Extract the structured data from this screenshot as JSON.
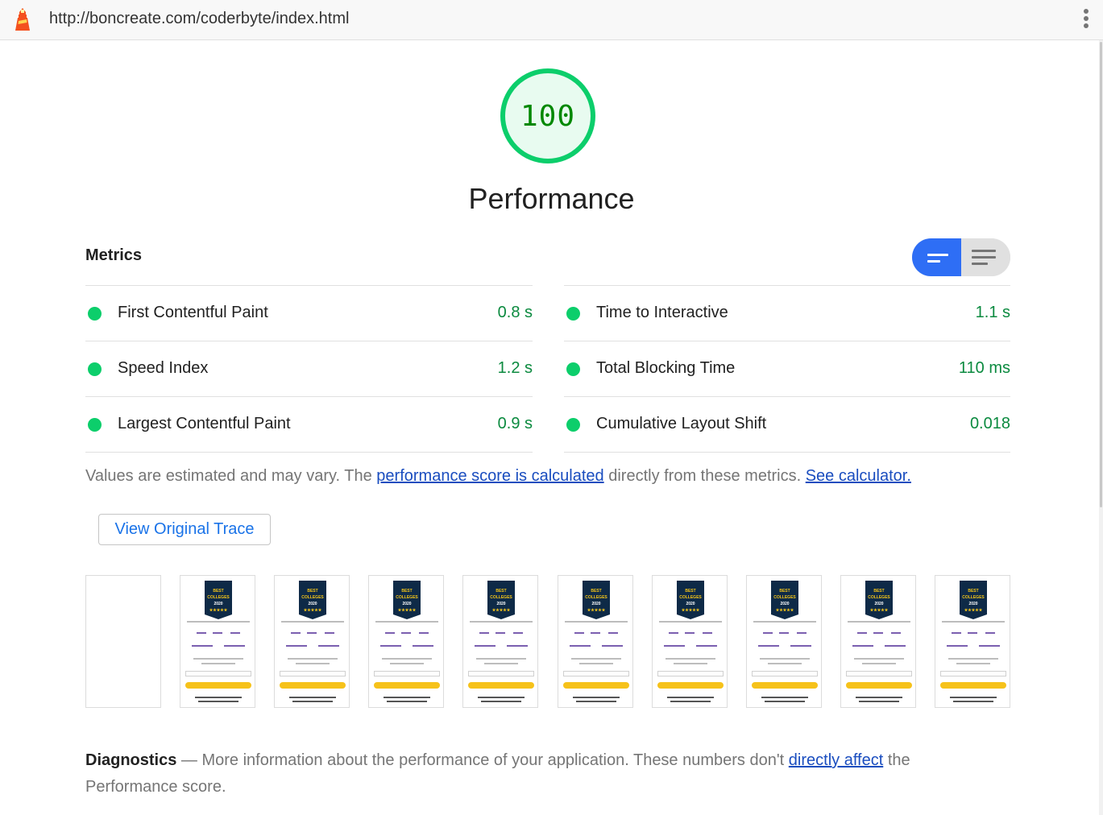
{
  "browser": {
    "url": "http://boncreate.com/coderbyte/index.html",
    "logo_icon": "lighthouse-icon",
    "menu_icon": "more-vert-icon"
  },
  "score": {
    "value": "100",
    "category": "Performance",
    "color": "#0cce6b"
  },
  "metrics": {
    "title": "Metrics",
    "left": [
      {
        "label": "First Contentful Paint",
        "value": "0.8 s"
      },
      {
        "label": "Speed Index",
        "value": "1.2 s"
      },
      {
        "label": "Largest Contentful Paint",
        "value": "0.9 s"
      }
    ],
    "right": [
      {
        "label": "Time to Interactive",
        "value": "1.1 s"
      },
      {
        "label": "Total Blocking Time",
        "value": "110 ms"
      },
      {
        "label": "Cumulative Layout Shift",
        "value": "0.018"
      }
    ],
    "status_color": "#0cce6b",
    "toggle": {
      "selected": "compact-view",
      "options": [
        "compact-view-icon",
        "expanded-view-icon"
      ]
    }
  },
  "note": {
    "prefix": "Values are estimated and may vary. The ",
    "link1": "performance score is calculated",
    "middle": " directly from these metrics. ",
    "link2": "See calculator."
  },
  "trace_button": "View Original Trace",
  "filmstrip": {
    "frames": 10,
    "badge_lines": [
      "BEST",
      "COLLEGES",
      "2020",
      "★★★★★"
    ]
  },
  "diagnostics": {
    "title": "Diagnostics",
    "dash": " — ",
    "text": "More information about the performance of your application. These numbers don't ",
    "link": "directly affect",
    "suffix": " the Performance score."
  }
}
